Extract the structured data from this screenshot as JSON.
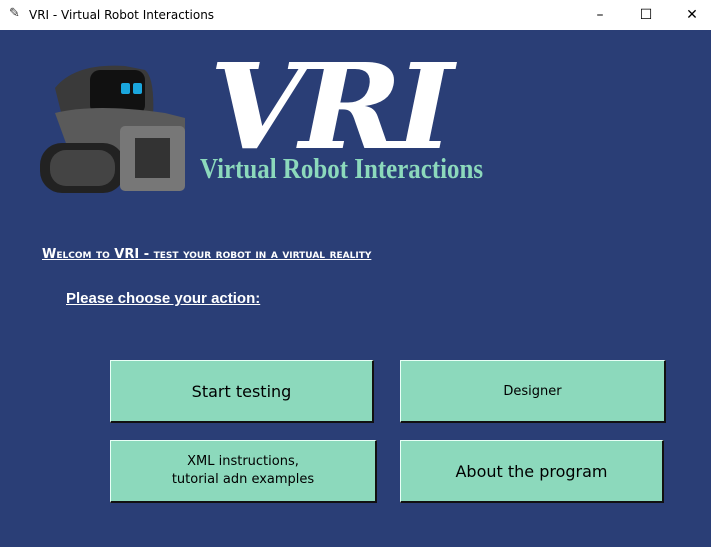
{
  "window": {
    "title": "VRI - Virtual Robot Interactions",
    "app_icon": "feather-icon",
    "minimize": "–",
    "maximize": "☐",
    "close": "✕"
  },
  "logo": {
    "text": "VRI",
    "subtitle": "Virtual Robot Interactions",
    "accent": "#8cd9bc"
  },
  "welcome": "Welcom to VRI - test your robot in a virtual reality",
  "prompt": "Please choose your action:",
  "buttons": {
    "start_testing": "Start testing",
    "designer": "Designer",
    "xml_line1": "XML instructions,",
    "xml_line2": "tutorial adn examples",
    "about": "About the program"
  },
  "colors": {
    "background": "#2a3e76",
    "button": "#8cd9bc"
  }
}
